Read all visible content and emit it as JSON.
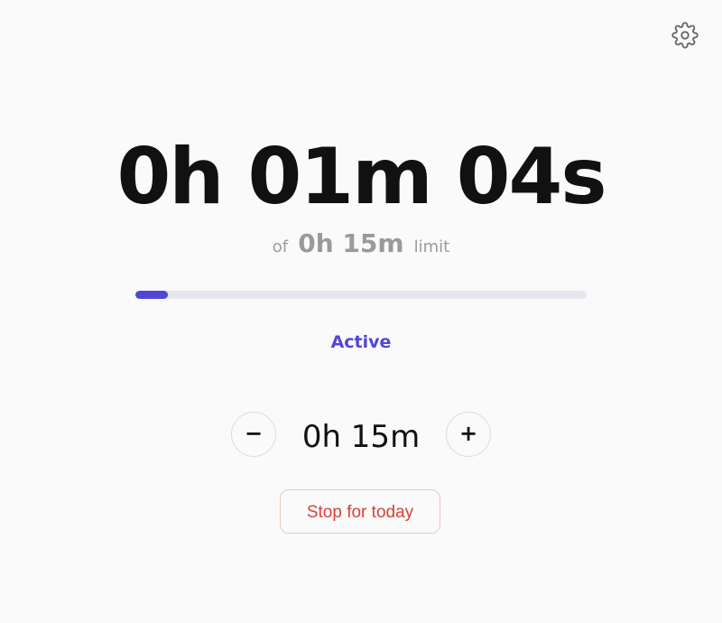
{
  "timer": {
    "elapsed": "0h 01m 04s",
    "limit_prefix": "of",
    "limit_value": "0h 15m",
    "limit_suffix": "limit",
    "progress_fraction": 0.071
  },
  "status": {
    "label": "Active",
    "color": "#5046d6"
  },
  "stepper": {
    "minus_label": "−",
    "value": "0h 15m",
    "plus_label": "+"
  },
  "actions": {
    "stop_label": "Stop for today",
    "stop_color": "#d8403a"
  },
  "icons": {
    "settings": "gear-icon"
  },
  "colors": {
    "accent": "#5046d6",
    "background": "#fafafa",
    "track": "#e6e6ec"
  }
}
